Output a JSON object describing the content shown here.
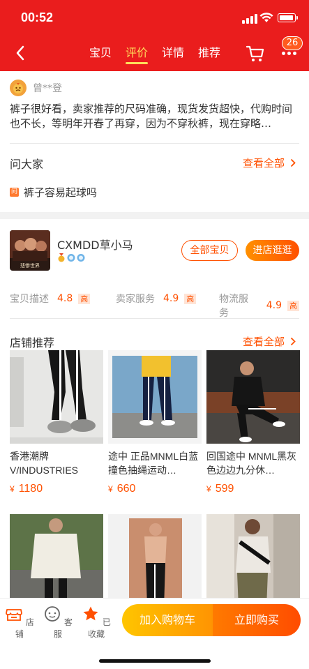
{
  "status": {
    "time": "00:52"
  },
  "nav": {
    "tabs": [
      {
        "label": "宝贝"
      },
      {
        "label": "评价"
      },
      {
        "label": "详情"
      },
      {
        "label": "推荐"
      }
    ],
    "active_tab": "评价",
    "badge_count": "26"
  },
  "review": {
    "reviewer": "曾**登",
    "text": "裤子很好看，卖家推荐的尺码准确，现货发货超快，代购时间也不长，等明年开春了再穿，因为不穿秋裤，现在穿略…"
  },
  "ask": {
    "title": "问大家",
    "view_all": "查看全部",
    "question_icon": "问",
    "question": "裤子容易起球吗"
  },
  "shop": {
    "name": "CXMDD草小马",
    "logo_caption": "悲惨世界",
    "all_items": "全部宝贝",
    "enter_shop": "进店逛逛",
    "ratings": [
      {
        "label": "宝贝描述",
        "score": "4.8",
        "tag": "高"
      },
      {
        "label": "卖家服务",
        "score": "4.9",
        "tag": "高"
      },
      {
        "label": "物流服务",
        "score": "4.9",
        "tag": "高"
      }
    ]
  },
  "recommend": {
    "title": "店铺推荐",
    "view_all": "查看全部",
    "currency": "¥",
    "products": [
      {
        "title": "香港潮牌 V/INDUSTRIES Vmade 黑…",
        "price": "1180"
      },
      {
        "title": "途中 正品MNML白蓝撞色抽绳运动…",
        "price": "660"
      },
      {
        "title": "回国途中 MNML黑灰色边边九分休…",
        "price": "599"
      }
    ]
  },
  "bottom": {
    "store": "店铺",
    "service": "客服",
    "favorited": "已收藏",
    "add_cart": "加入购物车",
    "buy_now": "立即购买"
  },
  "colors": {
    "header": "#ea1d1d",
    "accent": "#ff5000",
    "active_tab": "#ffde5c"
  },
  "icons": [
    "back-arrow-icon",
    "cart-icon",
    "more-icon",
    "chevron-right-icon",
    "store-icon",
    "service-icon",
    "star-icon",
    "medal-icon"
  ]
}
